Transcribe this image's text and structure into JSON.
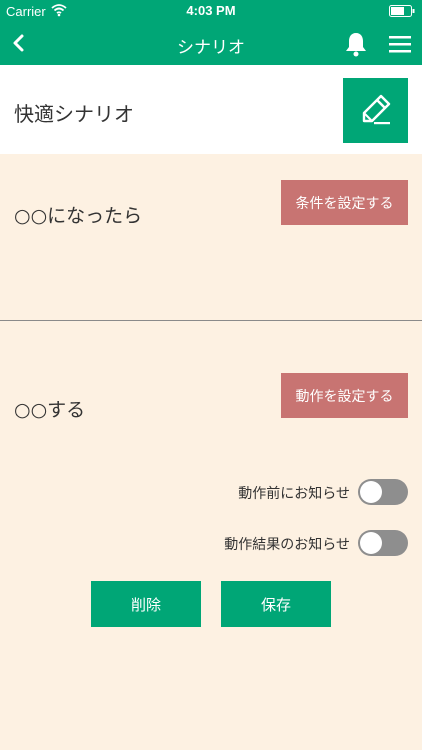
{
  "status_bar": {
    "carrier": "Carrier",
    "time": "4:03 PM"
  },
  "nav": {
    "title": "シナリオ",
    "icons": [
      "chevron-left-icon",
      "bell-icon",
      "hamburger-menu-icon"
    ]
  },
  "scenario": {
    "name": "快適シナリオ",
    "edit_icon": "pencil-edit-icon"
  },
  "condition": {
    "text": "○○になったら",
    "button_label": "条件を設定する"
  },
  "action": {
    "text": "○○する",
    "button_label": "動作を設定する"
  },
  "notifications": [
    {
      "label": "動作前にお知らせ",
      "on": false
    },
    {
      "label": "動作結果のお知らせ",
      "on": false
    }
  ],
  "buttons": {
    "delete_label": "削除",
    "save_label": "保存"
  },
  "colors": {
    "primary_green": "#00a676",
    "button_rose": "#c87472",
    "background_cream": "#fdf1e2",
    "toggle_off": "#8e8e8e"
  }
}
